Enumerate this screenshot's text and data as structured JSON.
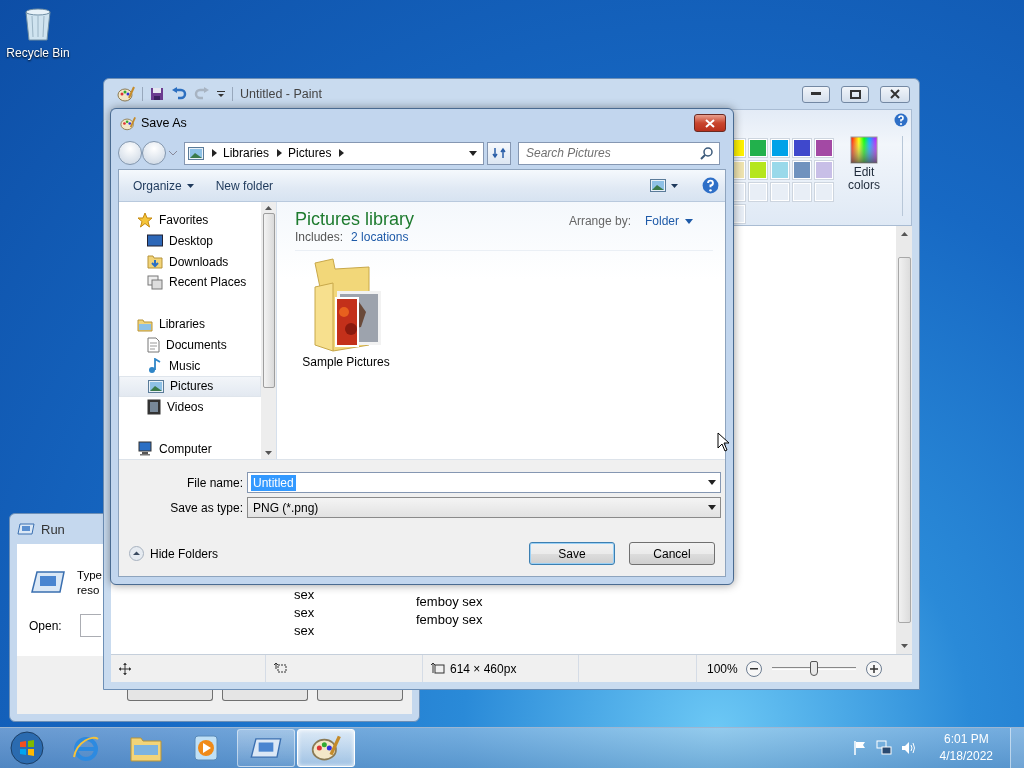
{
  "desktop": {
    "icons": [
      {
        "label": "Recycle Bin"
      }
    ]
  },
  "run_window": {
    "title": "Run",
    "text_lines": [
      "Type",
      "reso"
    ],
    "open_label": "Open:"
  },
  "paint_window": {
    "title": "Untitled - Paint",
    "palette": [
      {
        "color": "#fff200"
      },
      {
        "color": "#22b14c"
      },
      {
        "color": "#00a2e8"
      },
      {
        "color": "#3f48cc"
      },
      {
        "color": "#a349a4"
      },
      {
        "color": "#efe4b0"
      },
      {
        "color": "#b5e61d"
      },
      {
        "color": "#99d9ea"
      },
      {
        "color": "#7092be"
      },
      {
        "color": "#c8bfe7"
      }
    ],
    "edit_colors": "Edit colors",
    "canvas_columns": [
      {
        "lines": [
          "sex",
          "sex",
          "sex"
        ]
      },
      {
        "lines": [
          "femboy sex",
          "femboy sex"
        ]
      }
    ],
    "status": {
      "image_size": "614 × 460px",
      "zoom": "100%"
    },
    "zoom_slider": {
      "level": 0.5
    }
  },
  "save_as_dialog": {
    "title": "Save As",
    "breadcrumb": [
      "Libraries",
      "Pictures"
    ],
    "search_placeholder": "Search Pictures",
    "toolbar": [
      "Organize",
      "New folder"
    ],
    "nav": [
      {
        "label": "Favorites",
        "selected": false,
        "children": [
          {
            "label": "Desktop",
            "selected": false
          },
          {
            "label": "Downloads",
            "selected": false
          },
          {
            "label": "Recent Places",
            "selected": false
          }
        ]
      },
      {
        "label": "Libraries",
        "selected": false,
        "children": [
          {
            "label": "Documents",
            "selected": false
          },
          {
            "label": "Music",
            "selected": false
          },
          {
            "label": "Pictures",
            "selected": true
          },
          {
            "label": "Videos",
            "selected": false
          }
        ]
      },
      {
        "label": "Computer",
        "selected": false
      }
    ],
    "library_title": "Pictures library",
    "includes_label": "Includes:",
    "includes_link": "2 locations",
    "arrange_label": "Arrange by:",
    "arrange_value": "Folder",
    "items": [
      {
        "label": "Sample Pictures"
      }
    ],
    "file_name_label": "File name:",
    "file_name": "Untitled",
    "file_name_selected": true,
    "save_type_label": "Save as type:",
    "save_type": "PNG (*.png)",
    "hide_folders": "Hide Folders",
    "buttons": [
      {
        "label": "Save",
        "default": true
      },
      {
        "label": "Cancel",
        "default": false
      }
    ]
  },
  "taskbar": {
    "apps": [
      {
        "running": false,
        "selected": false
      },
      {
        "running": false,
        "selected": false
      },
      {
        "running": false,
        "selected": false
      },
      {
        "running": true,
        "selected": false
      },
      {
        "running": true,
        "selected": true
      }
    ],
    "clock": {
      "time": "6:01 PM",
      "date": "4/18/2022"
    }
  }
}
